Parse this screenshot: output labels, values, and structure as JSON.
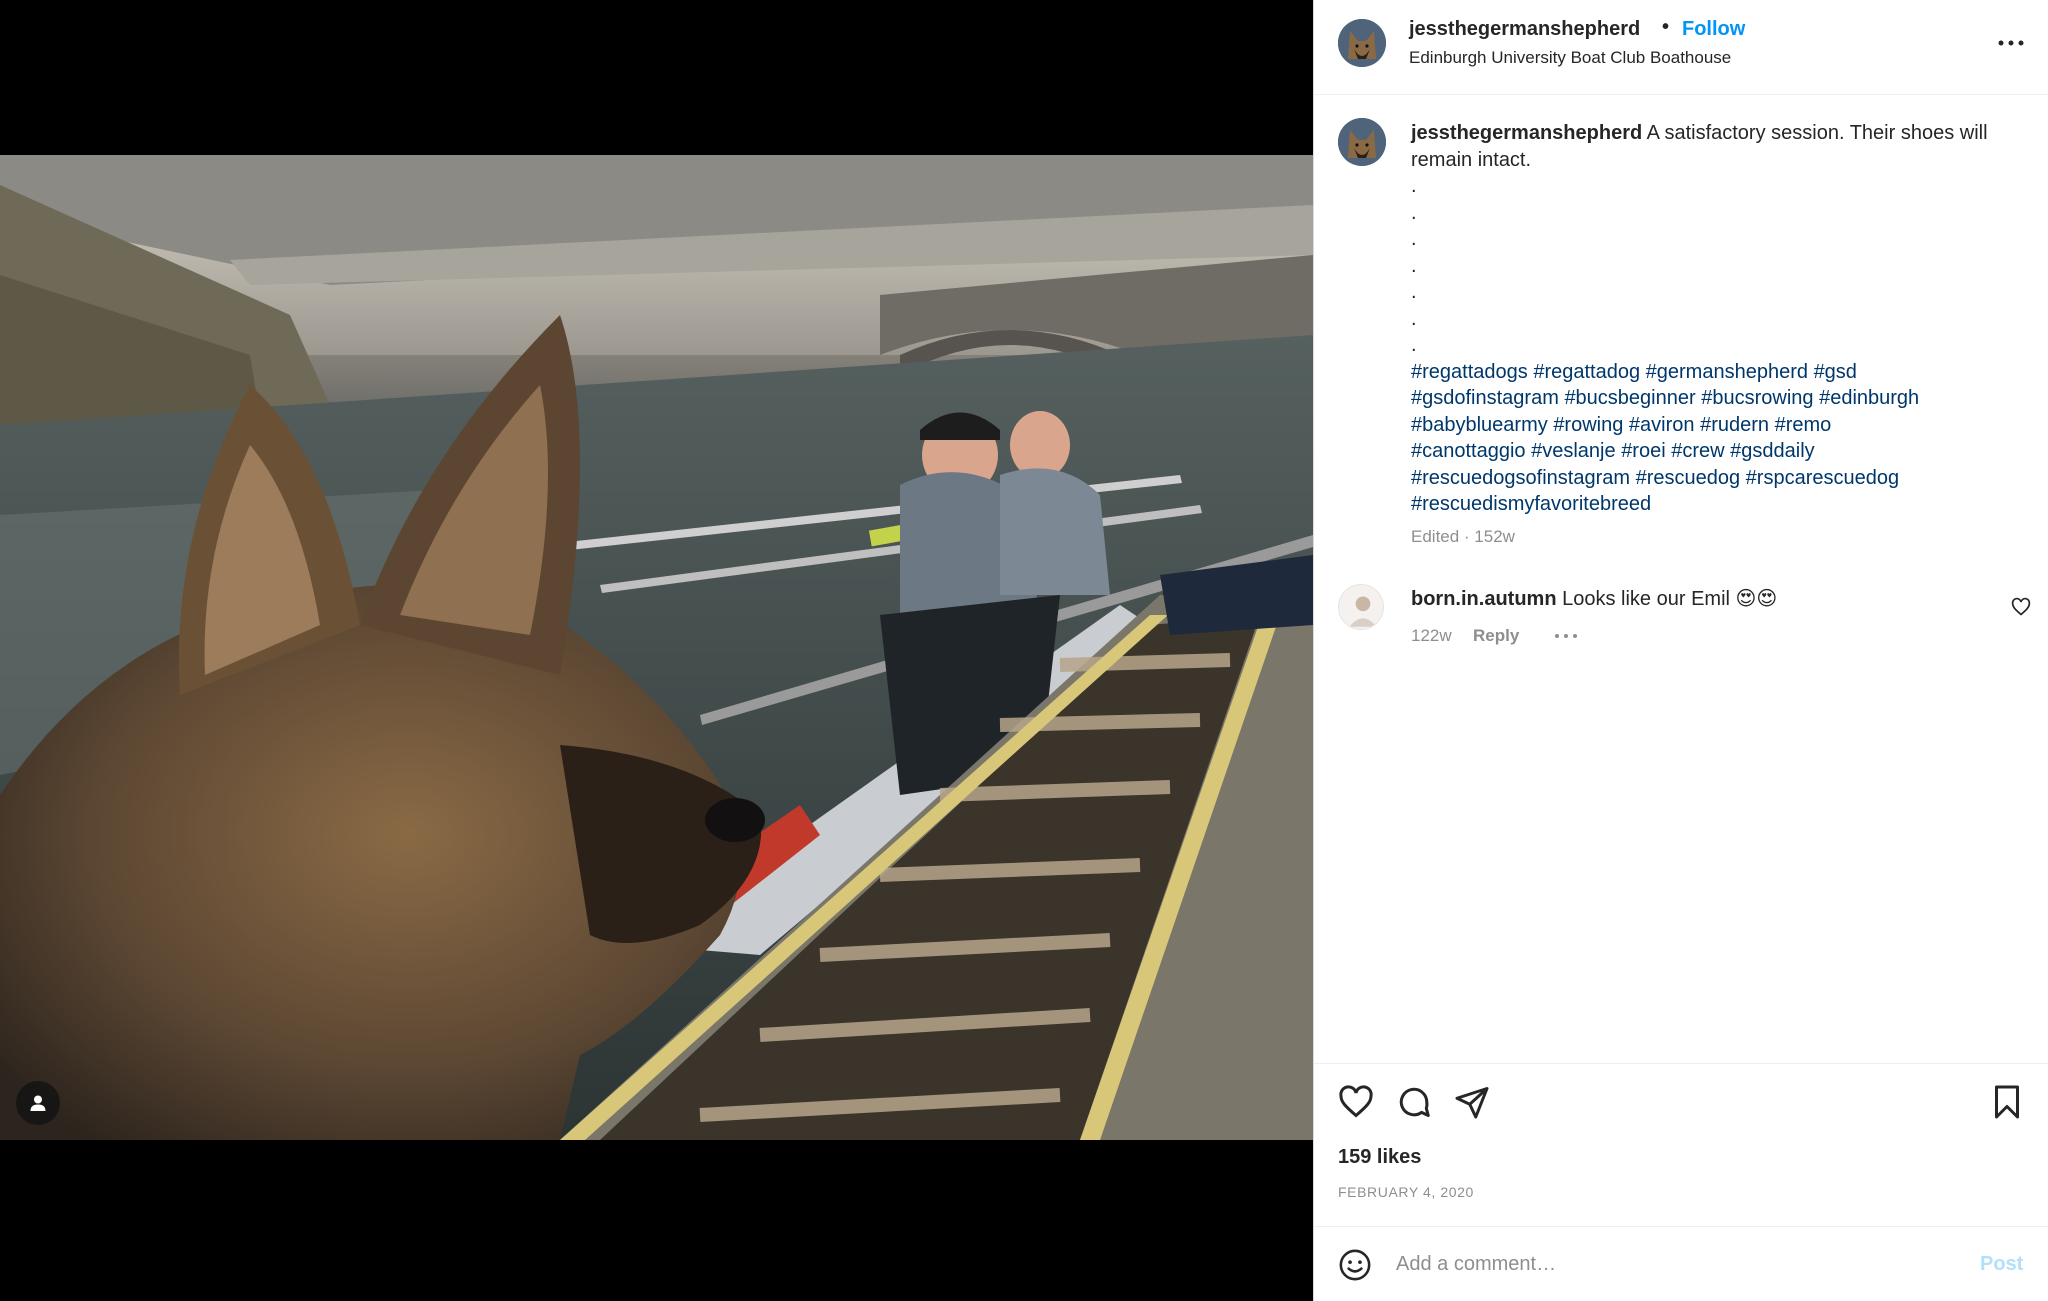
{
  "post": {
    "author": "jessthegermanshepherd",
    "follow_label": "Follow",
    "separator": "•",
    "location": "Edinburgh University Boat Club Boathouse",
    "more_icon": "more-horizontal-icon"
  },
  "caption": {
    "username": "jessthegermanshepherd",
    "text": "A satisfactory session. Their shoes will remain intact.",
    "dots": [
      ".",
      ".",
      ".",
      ".",
      ".",
      ".",
      "."
    ],
    "hashtags": [
      "#regattadogs",
      "#regattadog",
      "#germanshepherd",
      "#gsd",
      "#gsdofinstagram",
      "#bucsbeginner",
      "#bucsrowing",
      "#edinburgh",
      "#babybluearmy",
      "#rowing",
      "#aviron",
      "#rudern",
      "#remo",
      "#canottaggio",
      "#veslanje",
      "#roei",
      "#crew",
      "#gsddaily",
      "#rescuedogsofinstagram",
      "#rescuedog",
      "#rspcarescuedog",
      "#rescuedismyfavoritebreed"
    ],
    "edited": "Edited · 152w"
  },
  "comment": {
    "username": "born.in.autumn",
    "text": "Looks like our Emil 😍😍",
    "age": "122w",
    "reply_label": "Reply"
  },
  "actions": {
    "icons": [
      "heart-icon",
      "comment-icon",
      "share-icon",
      "bookmark-icon"
    ],
    "likes": "159 likes",
    "date": "February 4, 2020"
  },
  "add_comment": {
    "placeholder": "Add a comment…",
    "post_label": "Post"
  },
  "colors": {
    "link_blue": "#0095f6",
    "hashtag": "#00376b",
    "muted": "#8e8e8e",
    "post_disabled": "#b2dffc"
  }
}
